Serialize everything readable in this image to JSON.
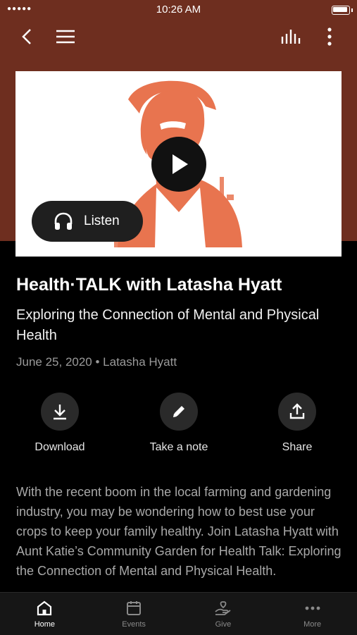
{
  "status_bar": {
    "signal": "●●●●● ",
    "time": "10:26 AM"
  },
  "header": {
    "back_icon": "chevron-left-icon",
    "menu_icon": "hamburger-menu-icon",
    "equalizer_icon": "equalizer-icon",
    "more_icon": "vertical-dots-icon",
    "background_color": "#6e2e1f"
  },
  "media": {
    "listen_label": "Listen",
    "play_icon": "play-icon",
    "headphones_icon": "headphones-icon",
    "accent_color": "#e8744f"
  },
  "episode": {
    "title": "Health·TALK with Latasha Hyatt",
    "subtitle": "Exploring the Connection of Mental and Physical Health",
    "meta": "June 25, 2020 • Latasha Hyatt"
  },
  "actions": [
    {
      "label": "Download",
      "icon": "download-icon"
    },
    {
      "label": "Take a note",
      "icon": "pencil-icon"
    },
    {
      "label": "Share",
      "icon": "share-icon"
    }
  ],
  "description": "With the recent boom in the local farming and gardening industry, you may be wondering how to best use your crops to keep your family healthy. Join Latasha Hyatt with Aunt Katie’s Community Garden for Health Talk: Exploring the Connection of Mental and Physical Health.",
  "tabs": [
    {
      "label": "Home",
      "icon": "home-icon",
      "active": true
    },
    {
      "label": "Events",
      "icon": "calendar-icon",
      "active": false
    },
    {
      "label": "Give",
      "icon": "give-icon",
      "active": false
    },
    {
      "label": "More",
      "icon": "more-horizontal-icon",
      "active": false
    }
  ]
}
